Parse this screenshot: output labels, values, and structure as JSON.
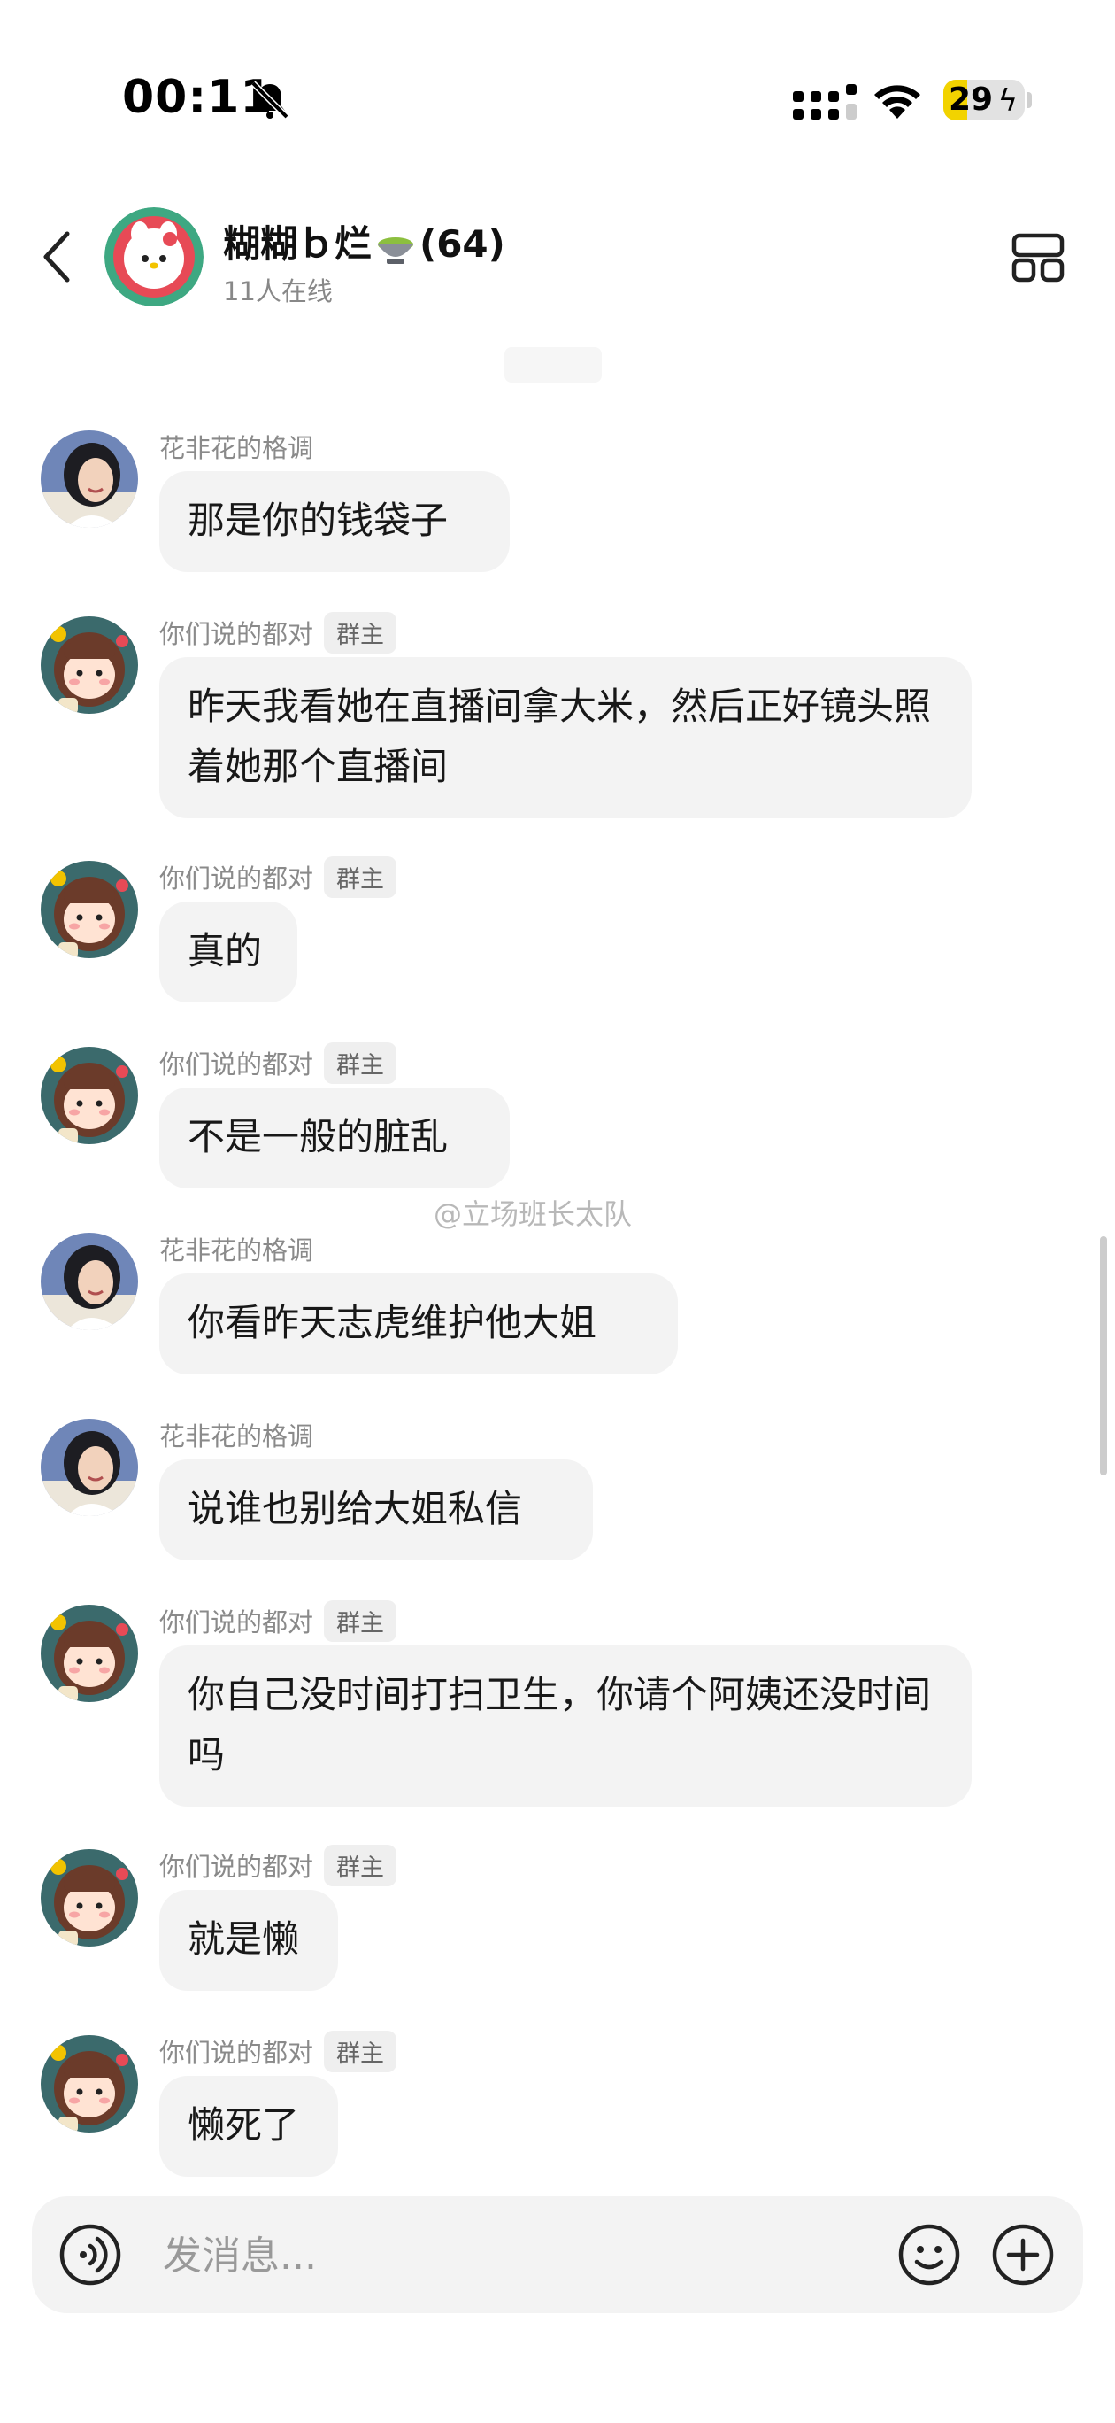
{
  "status": {
    "time": "00:11",
    "battery": "29",
    "battery_level": 0.29
  },
  "header": {
    "title": "糊糊ｂ烂",
    "member_count": "(64)",
    "online": "11人在线"
  },
  "owner_badge": "群主",
  "messages": [
    {
      "sender": "花非花的格调",
      "owner": false,
      "avatar": "girl",
      "text": "那是你的钱袋子"
    },
    {
      "sender": "你们说的都对",
      "owner": true,
      "avatar": "cartoon",
      "text": "昨天我看她在直播间拿大米，然后正好镜头照着她那个直播间"
    },
    {
      "sender": "你们说的都对",
      "owner": true,
      "avatar": "cartoon",
      "text": "真的"
    },
    {
      "sender": "你们说的都对",
      "owner": true,
      "avatar": "cartoon",
      "text": "不是一般的脏乱"
    },
    {
      "sender": "花非花的格调",
      "owner": false,
      "avatar": "girl",
      "text": "你看昨天志虎维护他大姐"
    },
    {
      "sender": "花非花的格调",
      "owner": false,
      "avatar": "girl",
      "text": "说谁也别给大姐私信"
    },
    {
      "sender": "你们说的都对",
      "owner": true,
      "avatar": "cartoon",
      "text": "你自己没时间打扫卫生，你请个阿姨还没时间吗"
    },
    {
      "sender": "你们说的都对",
      "owner": true,
      "avatar": "cartoon",
      "text": "就是懒"
    },
    {
      "sender": "你们说的都对",
      "owner": true,
      "avatar": "cartoon",
      "text": "懒死了"
    }
  ],
  "watermark": "@立场班长太队",
  "input": {
    "placeholder": "发消息..."
  },
  "icons": {
    "back": "chevron-left-icon",
    "bell": "bell-slash-icon",
    "signal": "signal-icon",
    "wifi": "wifi-icon",
    "battery": "battery-icon",
    "menu": "grid-menu-icon",
    "tea": "tea-bowl-icon",
    "voice": "voice-icon",
    "emoji": "smile-icon",
    "plus": "plus-icon"
  },
  "colors": {
    "bubble": "#f3f3f3",
    "badge": "#efefef",
    "battery_fill": "#f2d300"
  }
}
